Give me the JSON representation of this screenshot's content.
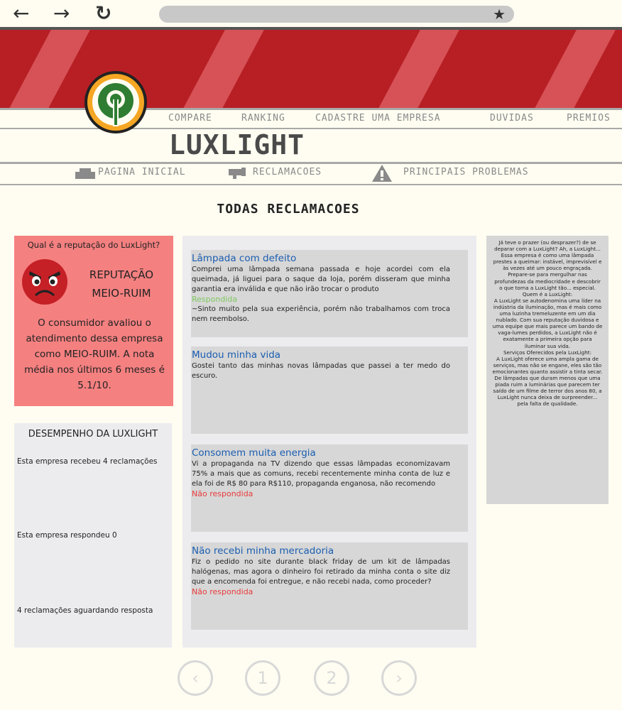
{
  "browser": {
    "back_icon": "←",
    "forward_icon": "→",
    "reload_icon": "↻",
    "star_icon": "★"
  },
  "nav": {
    "compare": "COMPARE",
    "ranking": "RANKING",
    "register": "CADASTRE UMA EMPRESA",
    "doubts": "DUVIDAS",
    "awards": "PREMIOS"
  },
  "brand": "LUXLIGHT",
  "subnav": {
    "home": "PAGINA INICIAL",
    "complaints": "RECLAMACOES",
    "problems": "PRINCIPAIS PROBLEMAS"
  },
  "page_title": "TODAS RECLAMACOES",
  "reputation": {
    "question": "Qual é a reputação do LuxLight?",
    "title_line1": "REPUTAÇÃO",
    "title_line2": "MEIO-RUIM",
    "description": "O consumidor avaliou o atendimento dessa empresa como MEIO-RUIM. A nota média nos últimos 6 meses é 5.1/10."
  },
  "performance": {
    "title": "DESEMPENHO DA LUXLIGHT",
    "received": "Esta empresa recebeu 4 reclamações",
    "answered": "Esta empresa respondeu 0",
    "waiting": "4 reclamações aguardando resposta"
  },
  "complaints": [
    {
      "title": "Lâmpada com defeito",
      "body": "Comprei uma lâmpada semana passada e hoje acordei com ela queimada, já liguei para o saque da loja, porém disseram que minha garantia era inválida e que não irão trocar o produto",
      "status": "Respondida",
      "reply": "~Sinto muito pela sua experiência, porém não trabalhamos com troca nem reembolso."
    },
    {
      "title": "Mudou minha vida",
      "body": "Gostei tanto das minhas novas lâmpadas que passei a ter medo do escuro.",
      "status": "",
      "reply": ""
    },
    {
      "title": "Consomem muita energia",
      "body": "Vi a propaganda na TV dizendo que essas lâmpadas economizavam 75% a mais que as comuns, recebi recentemente minha conta de luz e ela foi de R$ 80 para R$110, propaganda enganosa, não recomendo",
      "status": "Não respondida",
      "reply": ""
    },
    {
      "title": "Não recebi minha mercadoria",
      "body": "Fiz o pedido no site durante black friday de um kit de lâmpadas halógenas, mas agora o dinheiro foi retirado da minha conta o site diz que a encomenda foi entregue, e não recebi nada, como proceder?",
      "status": "Não respondida",
      "reply": ""
    }
  ],
  "about": {
    "intro": "Já teve o prazer (ou desprazer?) de se deparar com a LuxLight? Ah, a LuxLight... Essa empresa é como uma lâmpada prestes a queimar: instável, imprevisível e às vezes até um pouco engraçada. Prepare-se para mergulhar nas profundezas da mediocridade e descobrir o que torna a LuxLight tão... especial.",
    "who_title": "Quem é a LuxLight:",
    "who_text": "A LuxLight se autodenomina uma líder na indústria da iluminação, mas é mais como uma luzinha tremeluzente em um dia nublado. Com sua reputação duvidosa e uma equipe que mais parece um bando de vaga-lumes perdidos, a LuxLight não é exatamente a primeira opção para iluminar sua vida.",
    "services_title": "Serviços Oferecidos pela LuxLight:",
    "services_text": "A LuxLight oferece uma ampla gama de serviços, mas não se engane, eles são tão emocionantes quanto assistir a tinta secar. De lâmpadas que duram menos que uma piada ruim a luminárias que parecem ter saído de um filme de terror dos anos 80, a LuxLight nunca deixa de surpreender... pela falta de qualidade."
  },
  "pagination": {
    "prev": "‹",
    "page1": "1",
    "page2": "2",
    "next": "›"
  },
  "colors": {
    "banner_red": "#b71f24",
    "stripe_red": "#d65256",
    "reputation_bg": "#f58080",
    "link_blue": "#1a5db0",
    "answered_green": "#7ec860",
    "unanswered_red": "#e93b3b",
    "logo_green": "#2e7d32",
    "logo_yellow": "#f5a623"
  }
}
